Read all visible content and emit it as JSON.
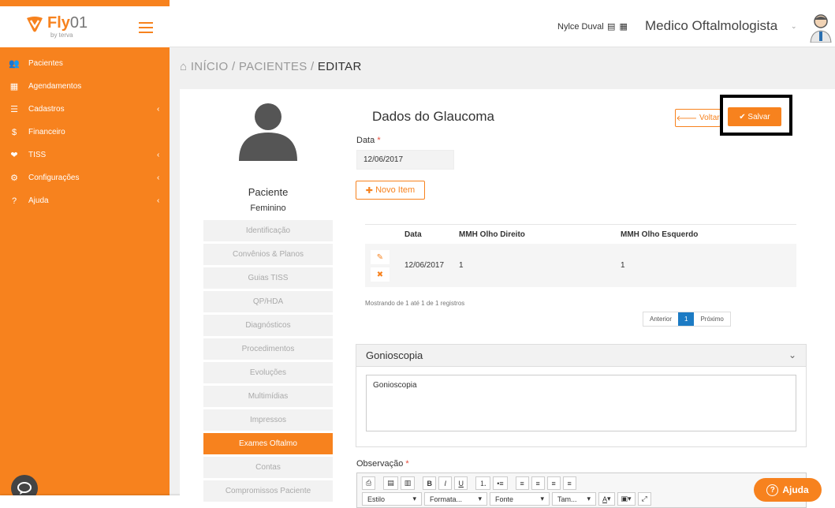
{
  "brand": {
    "name": "Fly",
    "suffix": "01",
    "by": "by terva"
  },
  "header": {
    "user_name": "Nylce Duval",
    "role": "Medico Oftalmologista",
    "role_chevron": "⌄"
  },
  "sidebar": {
    "items": [
      {
        "label": "Pacientes",
        "icon": "users-icon",
        "glyph": "👥",
        "has_chevron": false
      },
      {
        "label": "Agendamentos",
        "icon": "calendar-icon",
        "glyph": "▦",
        "has_chevron": false
      },
      {
        "label": "Cadastros",
        "icon": "list-icon",
        "glyph": "☰",
        "has_chevron": true
      },
      {
        "label": "Financeiro",
        "icon": "dollar-icon",
        "glyph": "$",
        "has_chevron": false
      },
      {
        "label": "TISS",
        "icon": "heart-icon",
        "glyph": "❤",
        "has_chevron": true
      },
      {
        "label": "Configurações",
        "icon": "gear-icon",
        "glyph": "⚙",
        "has_chevron": true
      },
      {
        "label": "Ajuda",
        "icon": "question-icon",
        "glyph": "?",
        "has_chevron": true
      }
    ],
    "chevron": "‹"
  },
  "breadcrumb": {
    "home_icon": "⌂",
    "home": "INÍCIO",
    "sep1": "/",
    "middle": "PACIENTES",
    "sep2": "/",
    "current": "EDITAR"
  },
  "patient": {
    "name": "Paciente",
    "sex": "Feminino"
  },
  "side_menu": [
    {
      "label": "Identificação",
      "active": false
    },
    {
      "label": "Convênios & Planos",
      "active": false
    },
    {
      "label": "Guias TISS",
      "active": false
    },
    {
      "label": "QP/HDA",
      "active": false
    },
    {
      "label": "Diagnósticos",
      "active": false
    },
    {
      "label": "Procedimentos",
      "active": false
    },
    {
      "label": "Evoluções",
      "active": false
    },
    {
      "label": "Multimídias",
      "active": false
    },
    {
      "label": "Impressos",
      "active": false
    },
    {
      "label": "Exames Oftalmo",
      "active": true
    },
    {
      "label": "Contas",
      "active": false
    },
    {
      "label": "Compromissos Paciente",
      "active": false
    }
  ],
  "form": {
    "title": "Dados do Glaucoma",
    "voltar_label": "Voltar",
    "salvar_label": "Salvar",
    "data_label": "Data",
    "required_mark": "*",
    "data_value": "12/06/2017",
    "novo_item_label": "Novo Item"
  },
  "table": {
    "headers": [
      "Data",
      "MMH Olho Direito",
      "MMH Olho Esquerdo"
    ],
    "rows": [
      {
        "data": "12/06/2017",
        "dir": "1",
        "esq": "1"
      }
    ],
    "summary": "Mostrando de 1 até 1 de 1 registros",
    "pager": {
      "prev": "Anterior",
      "current": "1",
      "next": "Próximo"
    }
  },
  "gonioscopia": {
    "title": "Gonioscopia",
    "value": "Gonioscopia"
  },
  "observacao": {
    "label": "Observação",
    "toolbar_combos": [
      "Estilo",
      "Formata...",
      "Fonte",
      "Tam..."
    ]
  },
  "help": {
    "label": "Ajuda"
  },
  "colors": {
    "accent": "#f7821e",
    "pager_active": "#1c7bc4",
    "required": "#e74c3c"
  }
}
